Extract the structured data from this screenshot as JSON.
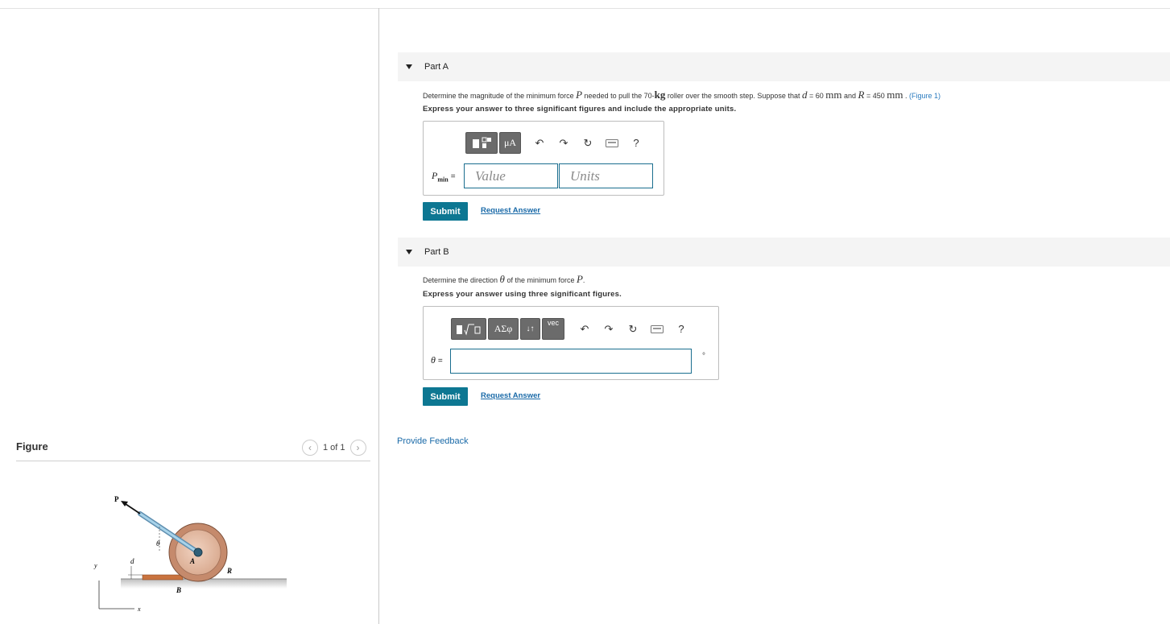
{
  "figure": {
    "title": "Figure",
    "pager": "1 of 1",
    "labels": {
      "p": "P",
      "theta": "θ",
      "d": "d",
      "a": "A",
      "r": "R",
      "b": "B",
      "y": "y",
      "x": "x"
    }
  },
  "part_a": {
    "title": "Part A",
    "question": {
      "prefix": "Determine the magnitude of the minimum force ",
      "var_p": "P",
      "mid1": " needed to pull the 70-",
      "unit_kg": "kg",
      "mid2": " roller over the smooth step. Suppose that ",
      "var_d": "d",
      "d_value": " = 60 ",
      "unit_mm1": "mm",
      "and": " and ",
      "var_r": "R",
      "r_value": " = 450 ",
      "unit_mm2": "mm",
      "period": " . ",
      "figure_link": "(Figure 1)"
    },
    "instruction": "Express your answer to three significant figures and include the appropriate units.",
    "toolbar": {
      "templates_label": "",
      "units_label": "μA",
      "help_label": "?"
    },
    "answer_label": "P",
    "answer_label_sub": "min",
    "equals": "=",
    "value_placeholder": "Value",
    "units_placeholder": "Units",
    "submit_label": "Submit",
    "request_label": "Request Answer"
  },
  "part_b": {
    "title": "Part B",
    "question": {
      "prefix": "Determine the direction ",
      "var_theta": "θ",
      "mid": " of the minimum force ",
      "var_p": "P",
      "end": "."
    },
    "instruction": "Express your answer using three significant figures.",
    "toolbar": {
      "greek_label": "ΑΣφ",
      "arrows_label": "↓↑",
      "vec_label": "vec",
      "help_label": "?"
    },
    "answer_label": "θ",
    "equals": "=",
    "unit_symbol": "°",
    "submit_label": "Submit",
    "request_label": "Request Answer"
  },
  "feedback_label": "Provide Feedback",
  "colors": {
    "accent": "#0d7792",
    "link": "#1a6aa8",
    "input_border": "#1a6e8f"
  }
}
